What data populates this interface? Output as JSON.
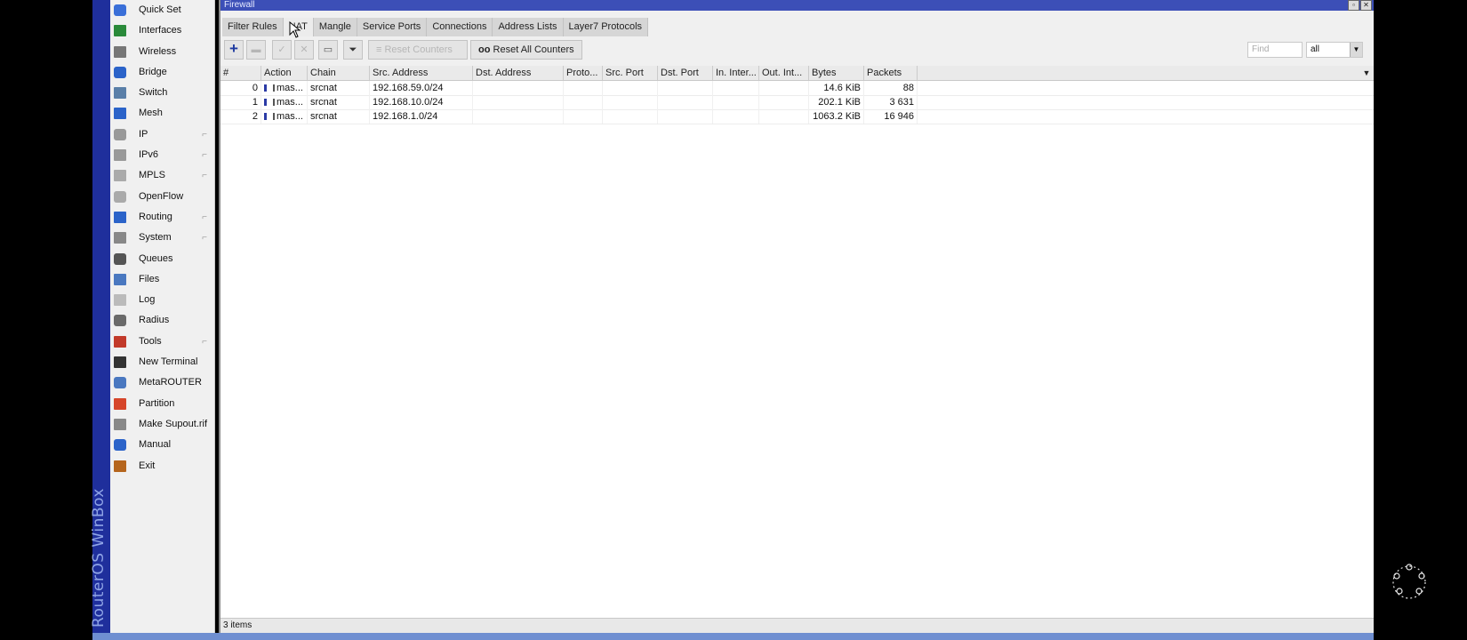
{
  "app": {
    "brand": "RouterOS WinBox"
  },
  "menu": {
    "items": [
      {
        "label": "Quick Set",
        "icon": "wand-icon",
        "color": "#3a6fd8",
        "submenu": false
      },
      {
        "label": "Interfaces",
        "icon": "interfaces-icon",
        "color": "#2a8a3a",
        "submenu": false
      },
      {
        "label": "Wireless",
        "icon": "wireless-icon",
        "color": "#777777",
        "submenu": false
      },
      {
        "label": "Bridge",
        "icon": "bridge-icon",
        "color": "#2b63c9",
        "submenu": false
      },
      {
        "label": "Switch",
        "icon": "switch-icon",
        "color": "#5a7fa8",
        "submenu": false
      },
      {
        "label": "Mesh",
        "icon": "mesh-icon",
        "color": "#2b63c9",
        "submenu": false
      },
      {
        "label": "IP",
        "icon": "ip-icon",
        "color": "#999999",
        "submenu": true
      },
      {
        "label": "IPv6",
        "icon": "ipv6-icon",
        "color": "#999999",
        "submenu": true
      },
      {
        "label": "MPLS",
        "icon": "mpls-icon",
        "color": "#aaaaaa",
        "submenu": true
      },
      {
        "label": "OpenFlow",
        "icon": "openflow-icon",
        "color": "#aaaaaa",
        "submenu": false
      },
      {
        "label": "Routing",
        "icon": "routing-icon",
        "color": "#2b63c9",
        "submenu": true
      },
      {
        "label": "System",
        "icon": "system-icon",
        "color": "#888888",
        "submenu": true
      },
      {
        "label": "Queues",
        "icon": "queues-icon",
        "color": "#555555",
        "submenu": false
      },
      {
        "label": "Files",
        "icon": "files-icon",
        "color": "#4a78c0",
        "submenu": false
      },
      {
        "label": "Log",
        "icon": "log-icon",
        "color": "#bbbbbb",
        "submenu": false
      },
      {
        "label": "Radius",
        "icon": "radius-icon",
        "color": "#6a6a6a",
        "submenu": false
      },
      {
        "label": "Tools",
        "icon": "tools-icon",
        "color": "#c23a2a",
        "submenu": true
      },
      {
        "label": "New Terminal",
        "icon": "terminal-icon",
        "color": "#333333",
        "submenu": false
      },
      {
        "label": "MetaROUTER",
        "icon": "metarouter-icon",
        "color": "#4a78c0",
        "submenu": false
      },
      {
        "label": "Partition",
        "icon": "partition-icon",
        "color": "#d6452a",
        "submenu": false
      },
      {
        "label": "Make Supout.rif",
        "icon": "supout-icon",
        "color": "#888888",
        "submenu": false
      },
      {
        "label": "Manual",
        "icon": "help-icon",
        "color": "#2b63c9",
        "submenu": false
      },
      {
        "label": "Exit",
        "icon": "exit-icon",
        "color": "#b5651d",
        "submenu": false
      }
    ]
  },
  "window": {
    "title": "Firewall",
    "tabs": [
      "Filter Rules",
      "NAT",
      "Mangle",
      "Service Ports",
      "Connections",
      "Address Lists",
      "Layer7 Protocols"
    ],
    "active_tab": "NAT",
    "toolbar": {
      "add": "+",
      "reset_counters": "Reset Counters",
      "reset_all_counters": "Reset All Counters",
      "reset_all_icon": "oo"
    },
    "find_placeholder": "Find",
    "filter_value": "all",
    "columns": [
      "#",
      "Action",
      "Chain",
      "Src. Address",
      "Dst. Address",
      "Proto...",
      "Src. Port",
      "Dst. Port",
      "In. Inter...",
      "Out. Int...",
      "Bytes",
      "Packets"
    ],
    "rows": [
      {
        "num": "0",
        "action": "mas...",
        "chain": "srcnat",
        "src": "192.168.59.0/24",
        "bytes": "14.6 KiB",
        "packets": "88"
      },
      {
        "num": "1",
        "action": "mas...",
        "chain": "srcnat",
        "src": "192.168.10.0/24",
        "bytes": "202.1 KiB",
        "packets": "3 631"
      },
      {
        "num": "2",
        "action": "mas...",
        "chain": "srcnat",
        "src": "192.168.1.0/24",
        "bytes": "1063.2 KiB",
        "packets": "16 946"
      }
    ],
    "status": "3 items"
  }
}
